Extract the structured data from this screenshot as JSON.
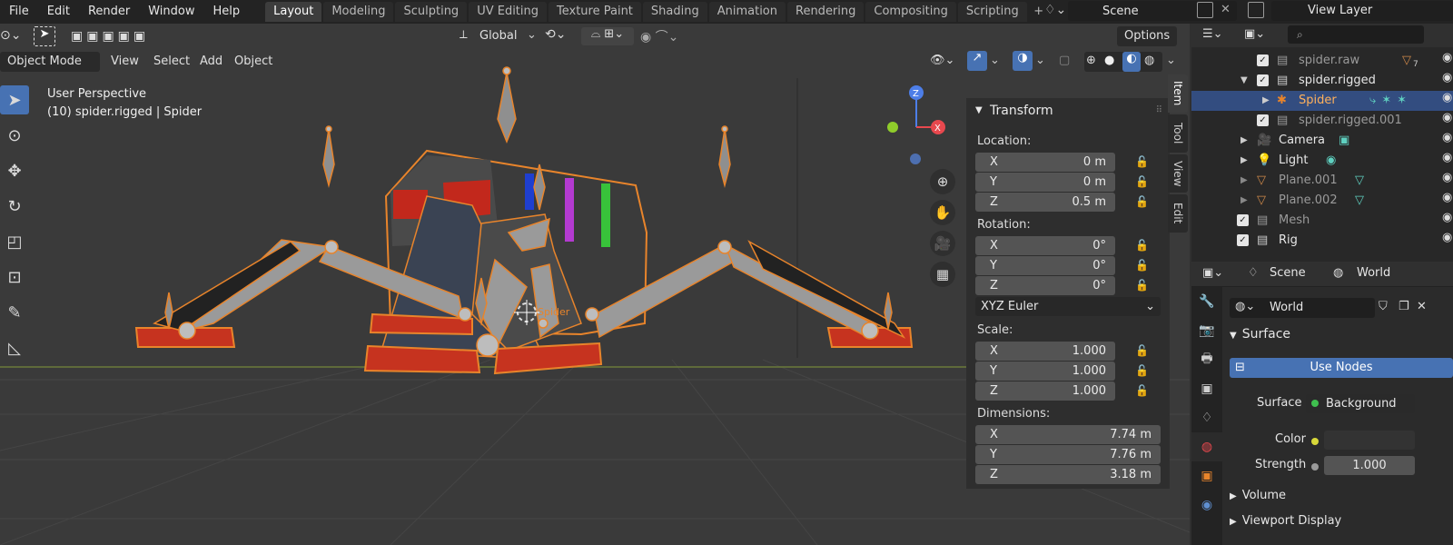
{
  "menu": [
    "File",
    "Edit",
    "Render",
    "Window",
    "Help"
  ],
  "workspaces": [
    "Layout",
    "Modeling",
    "Sculpting",
    "UV Editing",
    "Texture Paint",
    "Shading",
    "Animation",
    "Rendering",
    "Compositing",
    "Scripting"
  ],
  "active_workspace": "Layout",
  "scene": {
    "name": "Scene"
  },
  "view_layer": {
    "name": "View Layer"
  },
  "viewport": {
    "transform_orientation": "Global",
    "options_label": "Options",
    "mode": "Object Mode",
    "menus": [
      "View",
      "Select",
      "Add",
      "Object"
    ],
    "info_line1": "User Perspective",
    "info_line2": "(10) spider.rigged | Spider",
    "object_label": "Spider"
  },
  "npanel": {
    "title": "Transform",
    "location_label": "Location:",
    "location": [
      {
        "axis": "X",
        "value": "0 m"
      },
      {
        "axis": "Y",
        "value": "0 m"
      },
      {
        "axis": "Z",
        "value": "0.5 m"
      }
    ],
    "rotation_label": "Rotation:",
    "rotation": [
      {
        "axis": "X",
        "value": "0°"
      },
      {
        "axis": "Y",
        "value": "0°"
      },
      {
        "axis": "Z",
        "value": "0°"
      }
    ],
    "rotation_mode": "XYZ Euler",
    "scale_label": "Scale:",
    "scale": [
      {
        "axis": "X",
        "value": "1.000"
      },
      {
        "axis": "Y",
        "value": "1.000"
      },
      {
        "axis": "Z",
        "value": "1.000"
      }
    ],
    "dimensions_label": "Dimensions:",
    "dimensions": [
      {
        "axis": "X",
        "value": "7.74 m"
      },
      {
        "axis": "Y",
        "value": "7.76 m"
      },
      {
        "axis": "Z",
        "value": "3.18 m"
      }
    ],
    "tabs": [
      "Item",
      "Tool",
      "View",
      "Edit"
    ]
  },
  "outliner": {
    "rows": [
      {
        "name": "spider.raw",
        "dim": true,
        "badge": "7"
      },
      {
        "name": "spider.rigged",
        "dim": false
      },
      {
        "name": "Spider",
        "dim": false,
        "selected": true
      },
      {
        "name": "spider.rigged.001",
        "dim": true
      },
      {
        "name": "Camera",
        "dim": false
      },
      {
        "name": "Light",
        "dim": false
      },
      {
        "name": "Plane.001",
        "dim": true
      },
      {
        "name": "Plane.002",
        "dim": true
      },
      {
        "name": "Mesh",
        "dim": true
      },
      {
        "name": "Rig",
        "dim": false
      }
    ]
  },
  "properties": {
    "scene_label": "Scene",
    "world_label": "World",
    "world_name": "World",
    "surface_panel": "Surface",
    "use_nodes": "Use Nodes",
    "surface_label": "Surface",
    "surface_value": "Background",
    "color_label": "Color",
    "strength_label": "Strength",
    "strength_value": "1.000",
    "volume_panel": "Volume",
    "viewport_display_panel": "Viewport Display"
  },
  "colors": {
    "accent": "#4772b3",
    "selection_outline": "#e8842b",
    "mesh_red": "#d63a26"
  }
}
